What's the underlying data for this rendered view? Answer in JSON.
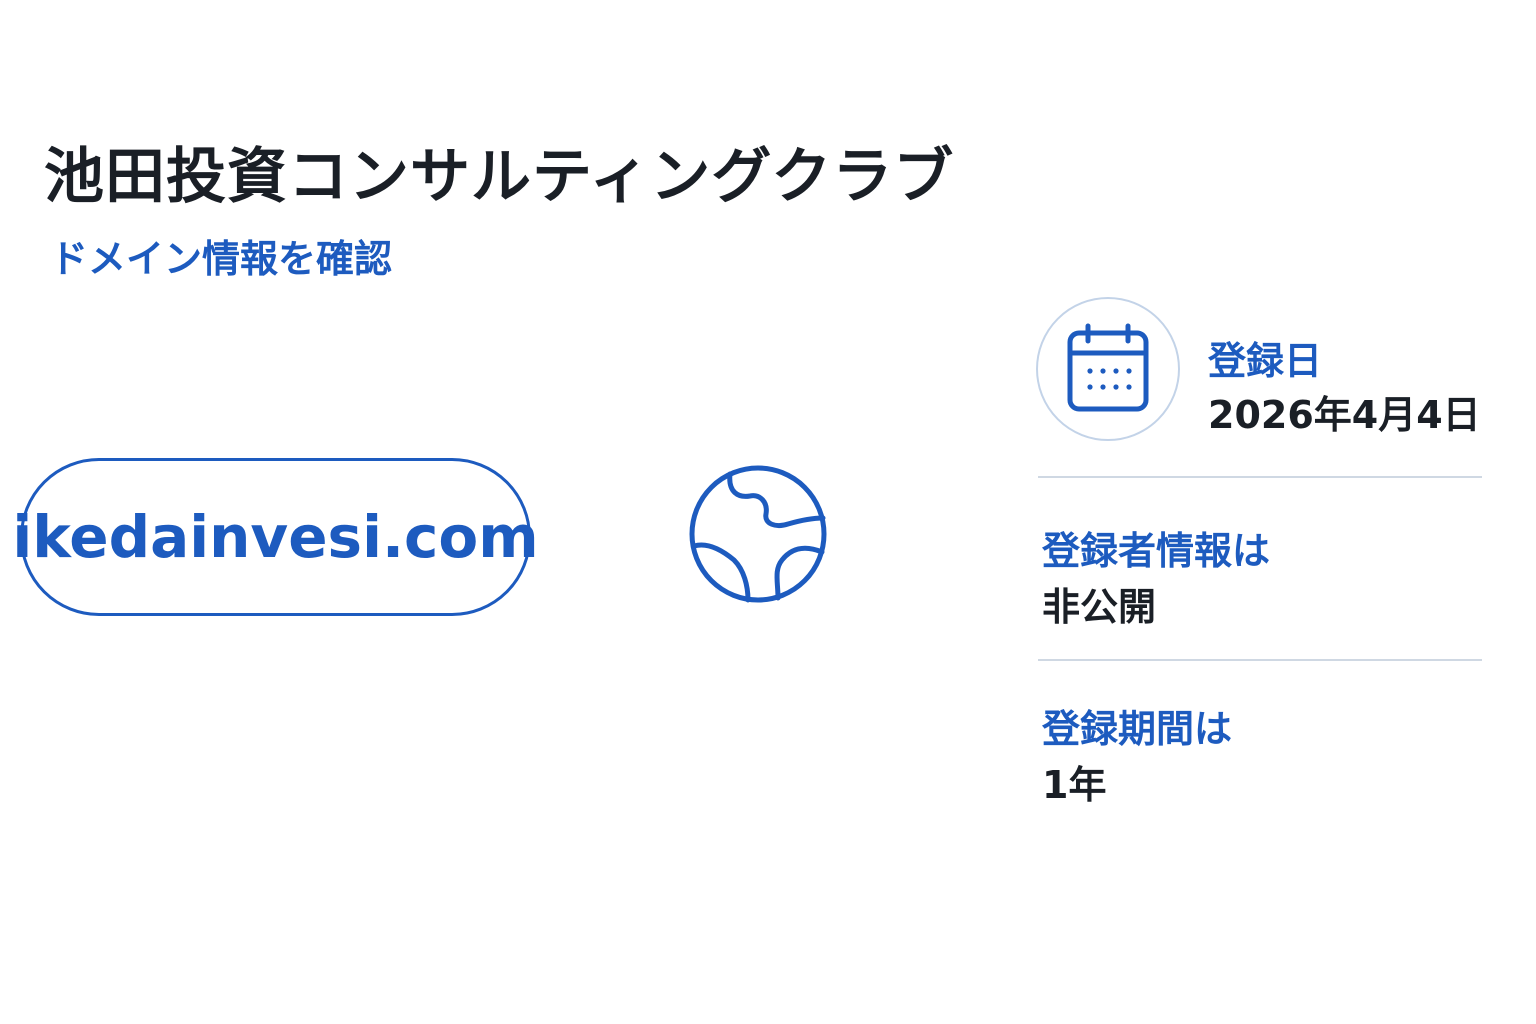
{
  "header": {
    "title": "池田投資コンサルティングクラブ",
    "link_label": "ドメイン情報を確認"
  },
  "domain": {
    "name": "ikedainvesi.com",
    "icon": "globe-icon"
  },
  "details": {
    "icon": "calendar-icon",
    "registered_label": "登録日",
    "registered_value": "2026年4月4日",
    "registrant_label": "登録者情報は",
    "registrant_value": "非公開",
    "period_label": "登録期間は",
    "period_value": "1年"
  },
  "colors": {
    "accent": "#1d5bbf",
    "text": "#1a1f26",
    "divider": "#cfd8e3",
    "icon_ring": "#c3d3e8",
    "background": "#ffffff"
  }
}
